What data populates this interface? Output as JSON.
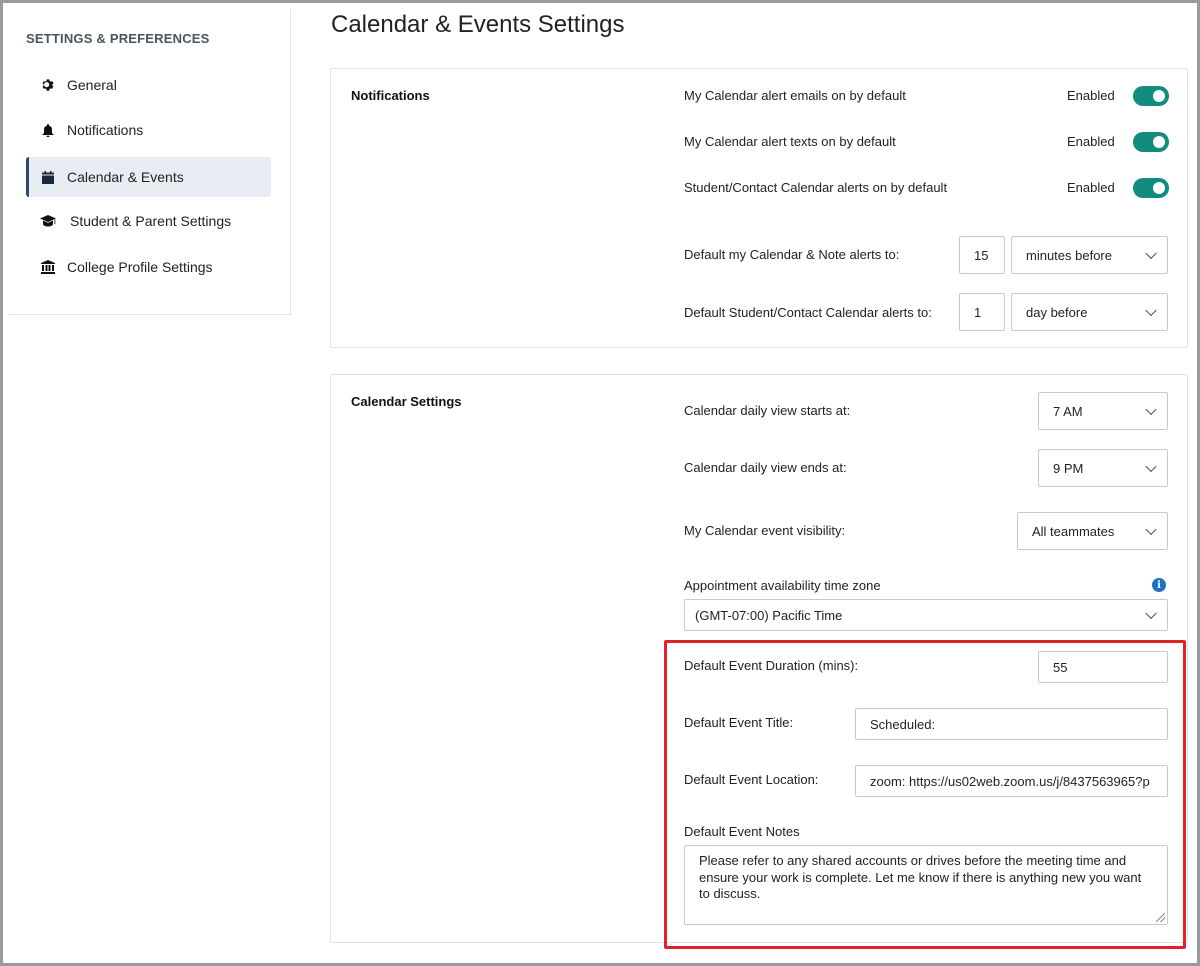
{
  "sidebar": {
    "heading": "SETTINGS & PREFERENCES",
    "items": [
      {
        "label": "General",
        "icon": "gear-icon"
      },
      {
        "label": "Notifications",
        "icon": "bell-icon"
      },
      {
        "label": "Calendar & Events",
        "icon": "calendar-icon",
        "active": true
      },
      {
        "label": "Student & Parent Settings",
        "icon": "graduation-cap-icon"
      },
      {
        "label": "College Profile Settings",
        "icon": "institution-icon"
      }
    ]
  },
  "page_title": "Calendar & Events Settings",
  "notifications": {
    "title": "Notifications",
    "toggles": [
      {
        "label": "My Calendar alert emails on by default",
        "status": "Enabled",
        "on": true
      },
      {
        "label": "My Calendar alert texts on by default",
        "status": "Enabled",
        "on": true
      },
      {
        "label": "Student/Contact Calendar alerts on by default",
        "status": "Enabled",
        "on": true
      }
    ],
    "my_alert": {
      "label": "Default my Calendar & Note alerts to:",
      "value": "15",
      "unit": "minutes before"
    },
    "student_alert": {
      "label": "Default Student/Contact Calendar alerts to:",
      "value": "1",
      "unit": "day before"
    }
  },
  "calendar": {
    "title": "Calendar Settings",
    "start": {
      "label": "Calendar daily view starts at:",
      "value": "7 AM"
    },
    "end": {
      "label": "Calendar daily view ends at:",
      "value": "9 PM"
    },
    "visibility": {
      "label": "My Calendar event visibility:",
      "value": "All teammates"
    },
    "timezone": {
      "label": "Appointment availability time zone",
      "value": "(GMT-07:00) Pacific Time",
      "info_glyph": "i"
    },
    "duration": {
      "label": "Default Event Duration (mins):",
      "value": "55"
    },
    "event_title": {
      "label": "Default Event Title:",
      "value": "Scheduled:"
    },
    "location": {
      "label": "Default Event Location:",
      "value": "zoom: https://us02web.zoom.us/j/8437563965?p"
    },
    "notes": {
      "label": "Default Event Notes",
      "value": "Please refer to any shared accounts or drives before the meeting time and ensure your work is complete. Let me know if there is anything new you want to discuss."
    }
  },
  "colors": {
    "toggle_on": "#128c7e",
    "highlight": "#e0202a",
    "active_nav": "#2b4a6d"
  }
}
